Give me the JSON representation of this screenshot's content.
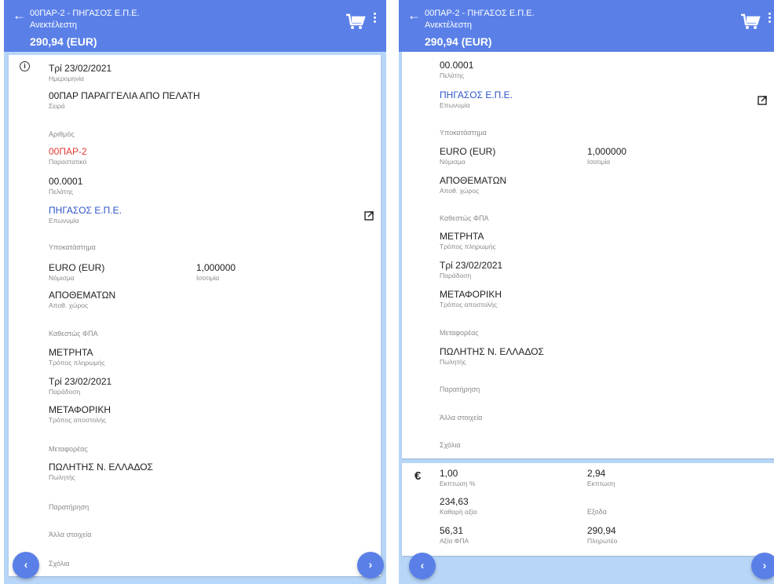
{
  "header": {
    "title": "00ΠΑΡ-2 - ΠΗΓΑΣΟΣ Ε.Π.Ε.",
    "status": "Ανεκτέλεστη",
    "amount": "290,94 (EUR)",
    "back_glyph": "←",
    "cart_icon": "cart-icon",
    "menu_icon": "more-vert-icon"
  },
  "colors": {
    "appbar": "#5a80e8",
    "background": "#b8d6f8",
    "red": "#e53935",
    "blue": "#2f55c8"
  },
  "nav": {
    "prev_glyph": "‹",
    "next_glyph": "›"
  },
  "left": {
    "date": {
      "value": "Τρί 23/02/2021",
      "label": "Ημερομηνία"
    },
    "series": {
      "value": "00ΠΑΡ ΠΑΡΑΓΓΕΛΙΑ ΑΠΟ ΠΕΛΑΤΗ",
      "label": "Σειρά"
    },
    "number": {
      "label": "Αριθμός"
    },
    "document": {
      "value": "00ΠΑΡ-2",
      "label": "Παραστατικό"
    },
    "customer": {
      "value": "00.0001",
      "label": "Πελάτης"
    },
    "name": {
      "value": "ΠΗΓΑΣΟΣ Ε.Π.Ε.",
      "label": "Επωνυμία"
    },
    "branch": {
      "label": "Υποκατάστημα"
    },
    "currency": {
      "value": "EURO (EUR)",
      "label": "Νόμισμα"
    },
    "parity": {
      "value": "1,000000",
      "label": "Ισοτιμία"
    },
    "warehouse": {
      "value": "ΑΠΟΘΕΜΑΤΩΝ",
      "label": "Αποθ. χώρος"
    },
    "vat_status": {
      "label": "Καθεστώς ΦΠΑ"
    },
    "payment": {
      "value": "ΜΕΤΡΗΤΑ",
      "label": "Τρόπος πληρωμής"
    },
    "delivery": {
      "value": "Τρί 23/02/2021",
      "label": "Παράδοση"
    },
    "shipping": {
      "value": "ΜΕΤΑΦΟΡΙΚΗ",
      "label": "Τρόπος αποστολής"
    },
    "carrier": {
      "label": "Μεταφορέας"
    },
    "seller": {
      "value": "ΠΩΛΗΤΗΣ Ν. ΕΛΛΑΔΟΣ",
      "label": "Πωλητής"
    },
    "remark": {
      "label": "Παρατήρηση"
    },
    "other": {
      "label": "Άλλα στοιχεία"
    },
    "comments": {
      "label": "Σχόλια"
    }
  },
  "right": {
    "customer": {
      "value": "00.0001",
      "label": "Πελάτης"
    },
    "name": {
      "value": "ΠΗΓΑΣΟΣ Ε.Π.Ε.",
      "label": "Επωνυμία"
    },
    "branch": {
      "label": "Υποκατάστημα"
    },
    "currency": {
      "value": "EURO (EUR)",
      "label": "Νόμισμα"
    },
    "parity": {
      "value": "1,000000",
      "label": "Ισοτιμία"
    },
    "warehouse": {
      "value": "ΑΠΟΘΕΜΑΤΩΝ",
      "label": "Αποθ. χώρος"
    },
    "vat_status": {
      "label": "Καθεστώς ΦΠΑ"
    },
    "payment": {
      "value": "ΜΕΤΡΗΤΑ",
      "label": "Τρόπος πληρωμής"
    },
    "delivery": {
      "value": "Τρί 23/02/2021",
      "label": "Παράδοση"
    },
    "shipping": {
      "value": "ΜΕΤΑΦΟΡΙΚΗ",
      "label": "Τρόπος αποστολής"
    },
    "carrier": {
      "label": "Μεταφορέας"
    },
    "seller": {
      "value": "ΠΩΛΗΤΗΣ Ν. ΕΛΛΑΔΟΣ",
      "label": "Πωλητής"
    },
    "remark": {
      "label": "Παρατήρηση"
    },
    "other": {
      "label": "Άλλα στοιχεία"
    },
    "comments": {
      "label": "Σχόλια"
    }
  },
  "totals": {
    "currency_glyph": "€",
    "discount_pct": {
      "value": "1,00",
      "label": "Εκπτωση %"
    },
    "discount": {
      "value": "2,94",
      "label": "Εκπτωση"
    },
    "net": {
      "value": "234,63",
      "label": "Καθαρή αξία"
    },
    "expenses": {
      "label": "Εξοδα"
    },
    "vat": {
      "value": "56,31",
      "label": "Αξία ΦΠΑ"
    },
    "payable": {
      "value": "290,94",
      "label": "Πληρωτέο"
    }
  }
}
